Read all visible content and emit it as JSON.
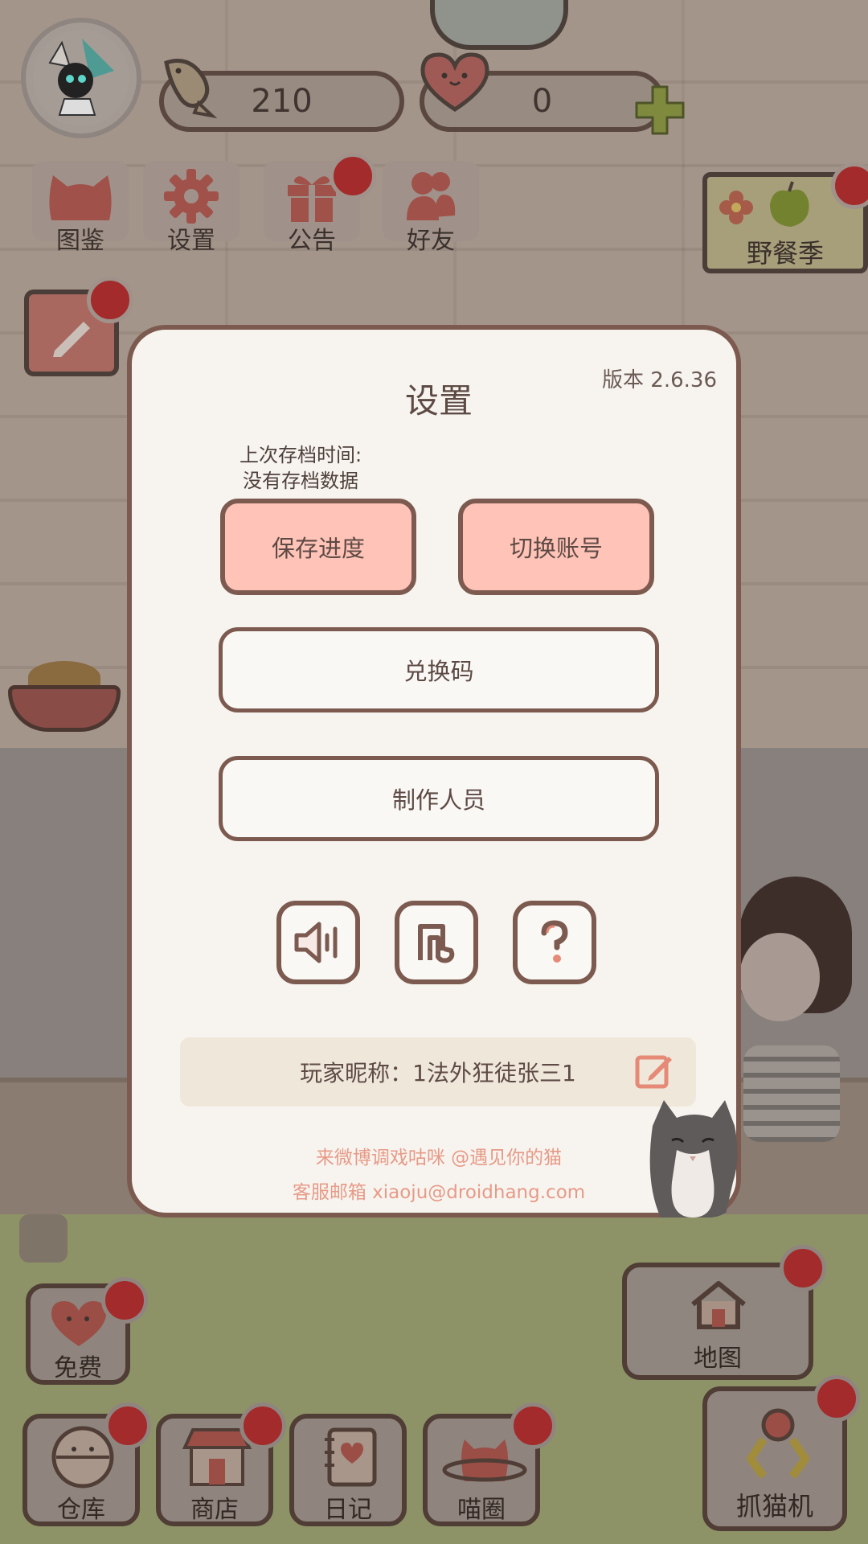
{
  "hud": {
    "fish_count": "210",
    "heart_count": "0"
  },
  "top_menu": {
    "items": [
      {
        "label": "图鉴",
        "icon": "cat-face-icon"
      },
      {
        "label": "设置",
        "icon": "gear-icon"
      },
      {
        "label": "公告",
        "icon": "gift-icon"
      },
      {
        "label": "好友",
        "icon": "friends-icon"
      }
    ]
  },
  "event": {
    "label": "野餐季"
  },
  "dialog": {
    "title": "设置",
    "version": "版本 2.6.36",
    "last_save_label": "上次存档时间:",
    "last_save_value": "没有存档数据",
    "save_button": "保存进度",
    "switch_account_button": "切换账号",
    "redeem_code_button": "兑换码",
    "credits_button": "制作人员",
    "nickname_text": "玩家昵称：1法外狂徒张三1",
    "weibo_text": "来微博调戏咕咪 @遇见你的猫",
    "email_text": "客服邮箱 xiaoju@droidhang.com"
  },
  "bottom": {
    "free_label": "免费",
    "map_label": "地图",
    "claw_label": "抓猫机",
    "dock": [
      {
        "label": "仓库"
      },
      {
        "label": "商店"
      },
      {
        "label": "日记"
      },
      {
        "label": "喵圈"
      }
    ]
  },
  "colors": {
    "accent_pink": "#ffc3b8",
    "border_brown": "#7c5a4f",
    "notification_red": "#a32b2b",
    "footer_text": "#e79a87"
  }
}
